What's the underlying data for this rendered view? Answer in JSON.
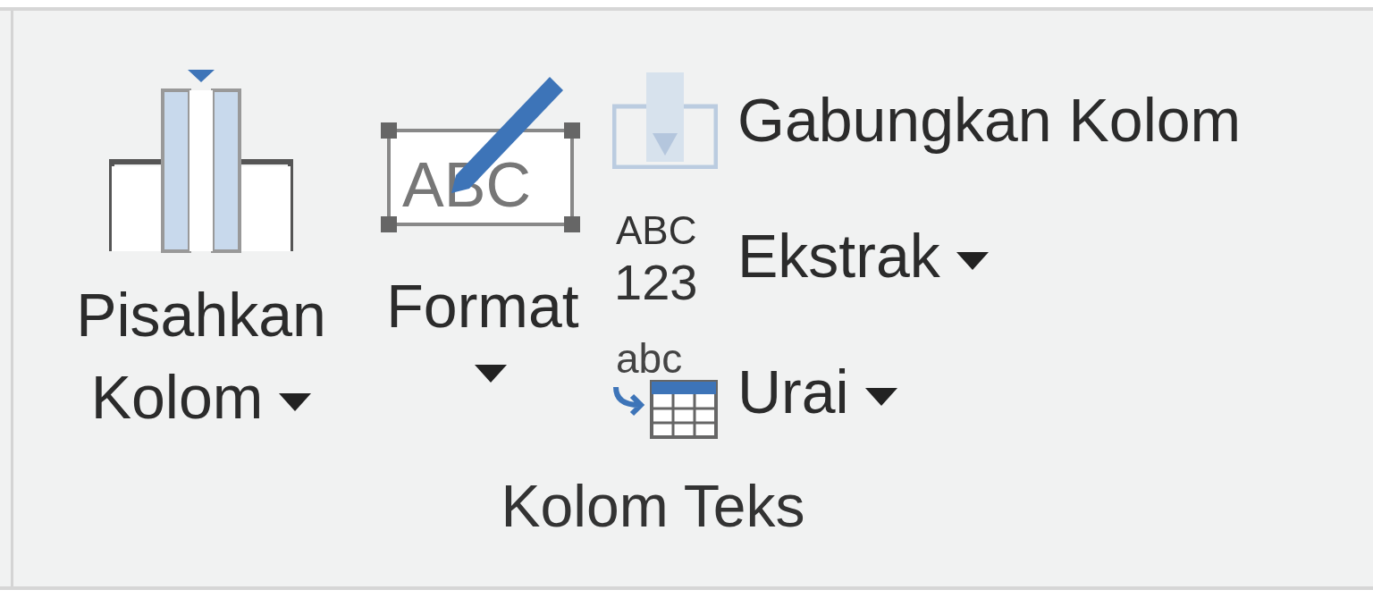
{
  "group": {
    "label": "Kolom Teks",
    "large_buttons": [
      {
        "kind": "split",
        "label": "Pisahkan Kolom",
        "dropdown": true
      },
      {
        "kind": "format",
        "label": "Format",
        "dropdown": true,
        "icon_text": "ABC"
      }
    ],
    "small_buttons": [
      {
        "kind": "merge",
        "label": "Gabungkan Kolom",
        "dropdown": false,
        "disabled": true
      },
      {
        "kind": "extract",
        "label": "Ekstrak",
        "dropdown": true,
        "disabled": false,
        "icon_text": [
          "ABC",
          "123"
        ]
      },
      {
        "kind": "parse",
        "label": "Urai",
        "dropdown": true,
        "disabled": false,
        "icon_text": "abc"
      }
    ]
  }
}
